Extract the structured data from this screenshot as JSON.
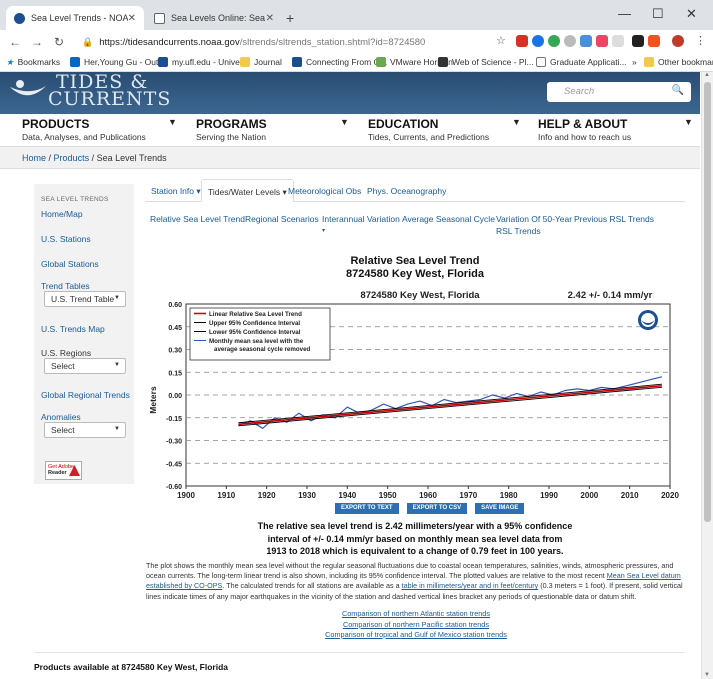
{
  "browser": {
    "tabs": [
      {
        "title": "Sea Level Trends - NOAA Tides &",
        "active": true
      },
      {
        "title": "Sea Levels Online: Sea Level Varia",
        "active": false
      }
    ],
    "url_domain": "https://tidesandcurrents.noaa.gov",
    "url_path": "/sltrends/sltrends_station.shtml?id=8724580",
    "bookmarks": [
      "Bookmarks",
      "Her,Young Gu - Out...",
      "my.ufl.edu - Univer...",
      "Journal",
      "Connecting From O...",
      "VMware Horizon",
      "Web of Science - Pl...",
      "Graduate Applicati..."
    ],
    "other_bookmarks": "Other bookmarks",
    "chevron": "»"
  },
  "site": {
    "logo_line1": "TIDES &",
    "logo_line2": "CURRENTS",
    "search_placeholder": "Search",
    "nav": [
      {
        "title": "PRODUCTS",
        "sub": "Data, Analyses, and Publications"
      },
      {
        "title": "PROGRAMS",
        "sub": "Serving the Nation"
      },
      {
        "title": "EDUCATION",
        "sub": "Tides, Currents, and Predictions"
      },
      {
        "title": "HELP & ABOUT",
        "sub": "Info and how to reach us"
      }
    ],
    "breadcrumb": [
      "Home",
      "Products",
      "Sea Level Trends"
    ]
  },
  "sidebar": {
    "heading": "SEA LEVEL TRENDS",
    "home_map": "Home/Map",
    "us_stations": "U.S. Stations",
    "global_stations": "Global Stations",
    "trend_tables": "Trend Tables",
    "trend_tables_value": "U.S. Trend Table",
    "us_trends_map": "U.S. Trends Map",
    "us_regions": "U.S. Regions",
    "us_regions_value": "Select",
    "global_regional": "Global Regional Trends",
    "anomalies": "Anomalies",
    "anomalies_value": "Select",
    "adobe_line1": "Get Adobe",
    "adobe_line2": "Reader"
  },
  "content": {
    "tabs": [
      "Station Info",
      "Tides/Water Levels",
      "Meteorological Obs",
      "Phys. Oceanography"
    ],
    "sublinks": [
      "Relative Sea Level Trend",
      "Regional Scenarios",
      "Interannual Variation",
      "Average Seasonal Cycle",
      "Variation Of 50-Year",
      "RSL Trends",
      "Previous RSL Trends"
    ],
    "title_line1": "Relative Sea Level Trend",
    "title_line2": "8724580 Key West, Florida",
    "buttons": [
      "EXPORT TO TEXT",
      "EXPORT TO CSV",
      "SAVE IMAGE"
    ],
    "summary_line1": "The relative sea level trend is 2.42 millimeters/year with a 95% confidence",
    "summary_line2": "interval of +/- 0.14 mm/yr based on monthly mean sea level data from",
    "summary_line3": "1913 to 2018 which is equivalent to a change of 0.79 feet in 100 years.",
    "para_a": "The plot shows the monthly mean sea level without the regular seasonal fluctuations due to coastal ocean temperatures, salinities, winds, atmospheric pressures, and ocean currents. The long-term linear trend is also shown, including its 95% confidence interval. The plotted values are relative to the most recent ",
    "para_link1": "Mean Sea Level datum established by CO-OPS",
    "para_b": ". The calculated trends for all stations are available as a ",
    "para_link2": "table in millimeters/year and in feet/century",
    "para_c": " (0.3 meters = 1 foot). If present, solid vertical lines indicate times of any major earthquakes in the vicinity of the station and dashed vertical lines bracket any periods of questionable data or datum shift.",
    "comparisons": [
      "Comparison of northern Atlantic station trends",
      "Comparison of northern Pacific station trends",
      "Comparison of tropical and Gulf of Mexico station trends"
    ],
    "products_heading": "Products available at 8724580 Key West, Florida"
  },
  "chart_data": {
    "type": "line",
    "header_station": "8724580 Key West, Florida",
    "header_rate": "2.42 +/-  0.14 mm/yr",
    "ylabel": "Meters",
    "xlabel": "",
    "xlim": [
      1900,
      2020
    ],
    "ylim": [
      -0.6,
      0.6
    ],
    "x_ticks": [
      1900,
      1910,
      1920,
      1930,
      1940,
      1950,
      1960,
      1970,
      1980,
      1990,
      2000,
      2010,
      2020
    ],
    "y_tick_labels": [
      "0.60",
      "0.45",
      "0.30",
      "0.15",
      "0.00",
      "-0.15",
      "-0.30",
      "-0.45",
      "-0.60"
    ],
    "legend": [
      "Linear Relative Sea Level Trend",
      "Upper 95% Confidence Interval",
      "Lower 95% Confidence Interval",
      "Monthly mean sea level with the average seasonal cycle removed"
    ],
    "legend_position": "top-left",
    "grid": "dashed horizontal",
    "series": [
      {
        "name": "Linear Relative Sea Level Trend",
        "color": "#cc0000",
        "x": [
          1913,
          2018
        ],
        "y": [
          -0.193,
          0.061
        ]
      },
      {
        "name": "Upper 95% Confidence Interval",
        "color": "#000000",
        "x": [
          1913,
          2018
        ],
        "y": [
          -0.183,
          0.071
        ]
      },
      {
        "name": "Lower 95% Confidence Interval",
        "color": "#000000",
        "x": [
          1913,
          2018
        ],
        "y": [
          -0.203,
          0.051
        ]
      },
      {
        "name": "Monthly mean sea level with the average seasonal cycle removed",
        "color": "#3355bb",
        "x": [
          1913,
          1916,
          1919,
          1922,
          1925,
          1928,
          1931,
          1934,
          1937,
          1940,
          1943,
          1946,
          1949,
          1952,
          1955,
          1958,
          1961,
          1964,
          1967,
          1970,
          1973,
          1976,
          1979,
          1982,
          1985,
          1988,
          1991,
          1994,
          1997,
          2000,
          2003,
          2006,
          2009,
          2012,
          2015,
          2018
        ],
        "y": [
          -0.2,
          -0.17,
          -0.22,
          -0.15,
          -0.18,
          -0.12,
          -0.17,
          -0.13,
          -0.15,
          -0.08,
          -0.12,
          -0.1,
          -0.06,
          -0.09,
          -0.06,
          -0.04,
          -0.07,
          -0.03,
          -0.05,
          -0.04,
          -0.03,
          0.0,
          -0.02,
          0.01,
          -0.01,
          0.02,
          0.0,
          0.03,
          0.04,
          0.03,
          0.05,
          0.04,
          0.06,
          0.08,
          0.1,
          0.12
        ]
      }
    ],
    "colors": {
      "trend": "#cc0000",
      "ci": "#000000",
      "monthly": "#3355bb",
      "grid": "#888888"
    }
  }
}
